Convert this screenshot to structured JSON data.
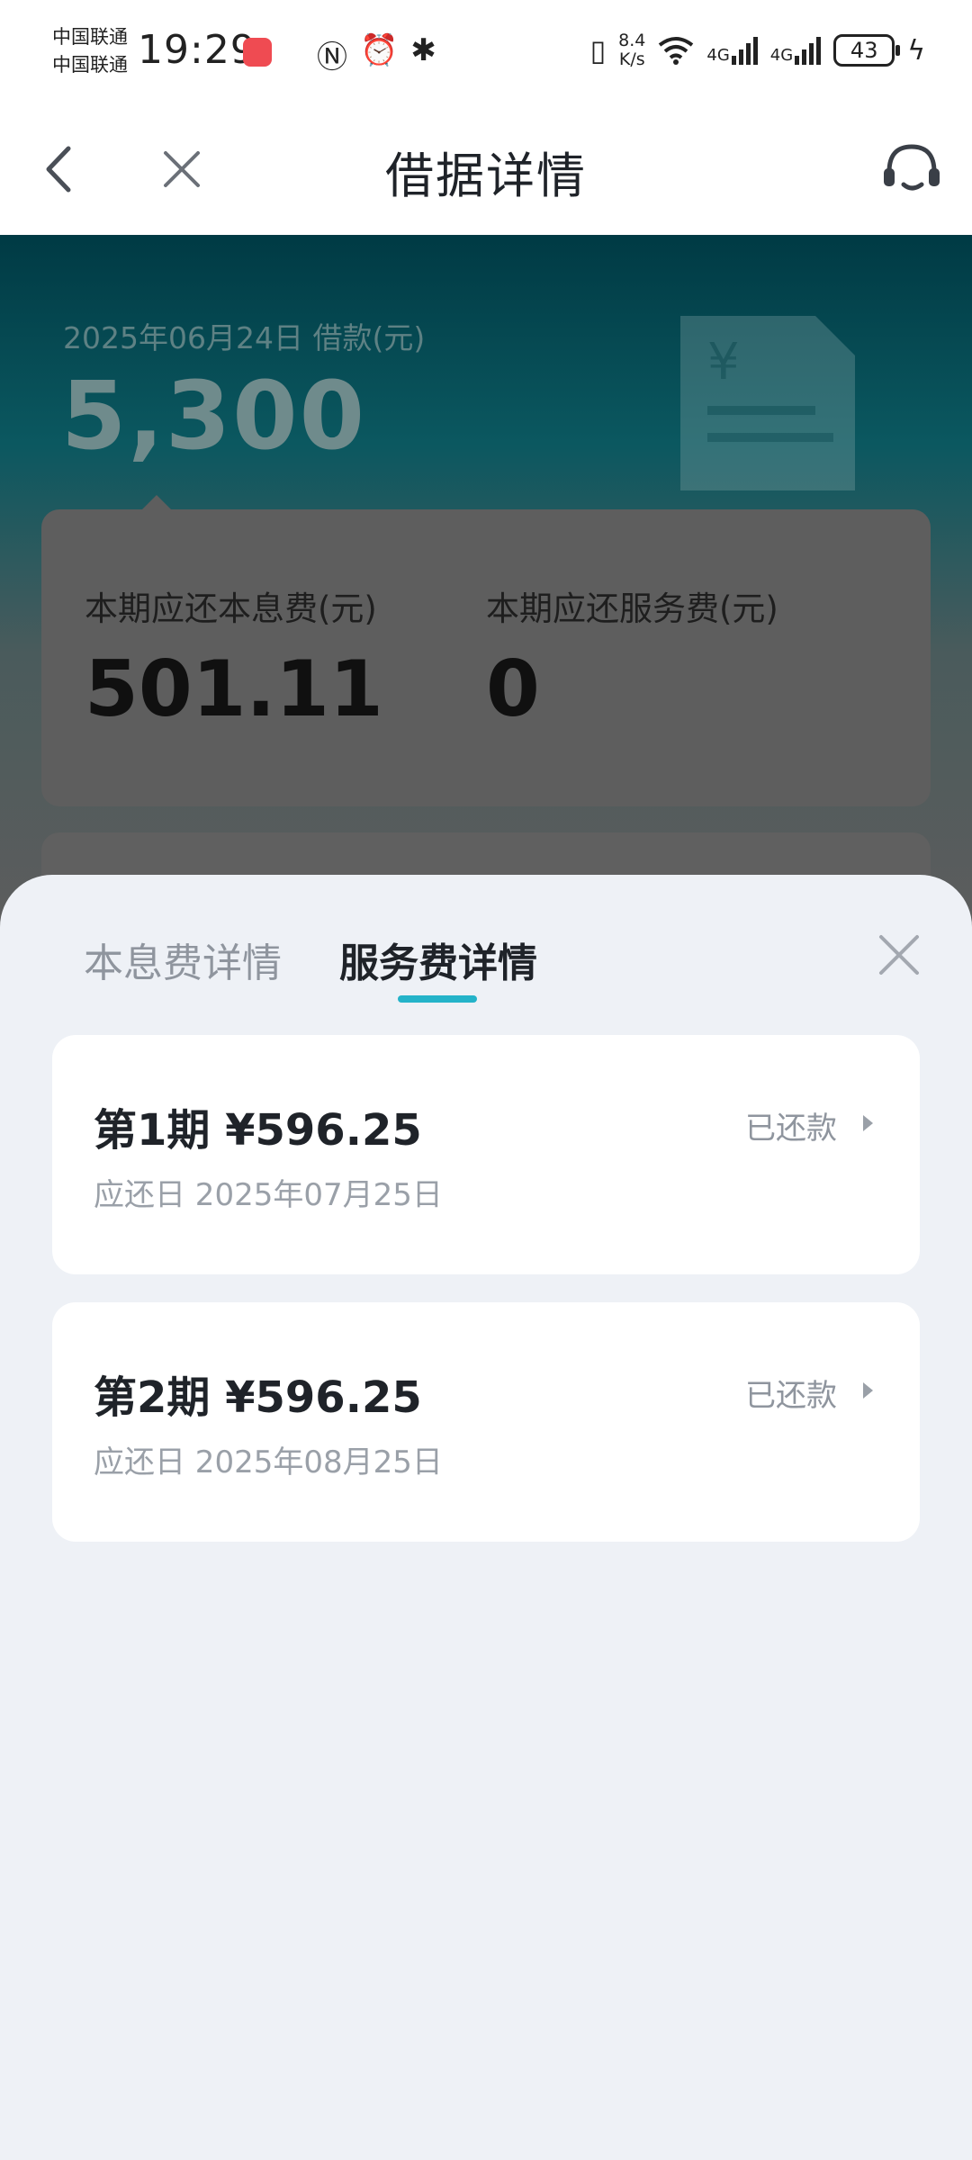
{
  "status_bar": {
    "carrier_1": "中国联通",
    "carrier_2": "中国联通",
    "time": "19:29",
    "net_speed_value": "8.4",
    "net_speed_unit": "K/s",
    "signal_1_label": "4G",
    "signal_2_label": "4G",
    "battery": "43",
    "icons": [
      "nfc-icon",
      "alarm-icon",
      "bluetooth-icon",
      "vibrate-icon",
      "wifi-icon",
      "charging-icon"
    ]
  },
  "navbar": {
    "title": "借据详情"
  },
  "hero": {
    "date_label": "2025年06月24日 借款(元)",
    "amount": "5,300",
    "principal_interest_label": "本期应还本息费(元)",
    "principal_interest_value": "501.11",
    "service_fee_label": "本期应还服务费(元)",
    "service_fee_value": "0"
  },
  "sheet": {
    "tabs": [
      {
        "label": "本息费详情",
        "active": false
      },
      {
        "label": "服务费详情",
        "active": true
      }
    ],
    "installments": [
      {
        "title": "第1期 ¥596.25",
        "due_date": "应还日 2025年07月25日",
        "status": "已还款"
      },
      {
        "title": "第2期 ¥596.25",
        "due_date": "应还日 2025年08月25日",
        "status": "已还款"
      }
    ]
  },
  "colors": {
    "accent": "#24b3c9",
    "sheet_bg": "#eef1f6",
    "hero_top": "#003a44"
  }
}
